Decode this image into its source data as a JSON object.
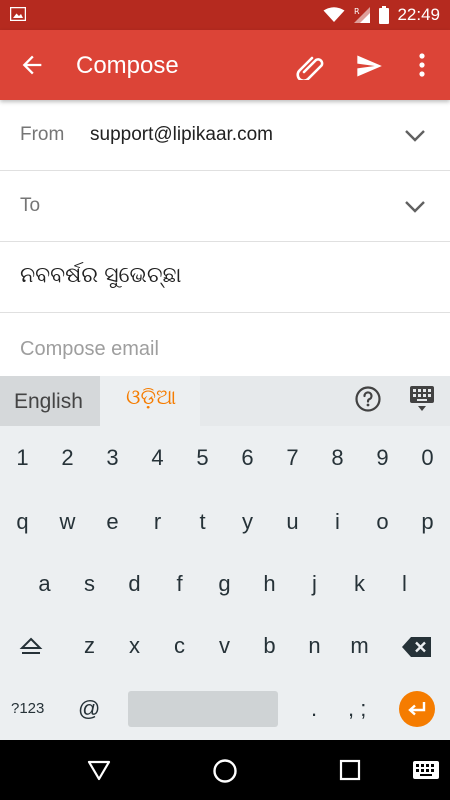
{
  "status_bar": {
    "time": "22:49",
    "icons": [
      "image-icon",
      "wifi-icon",
      "signal-icon",
      "battery-icon"
    ]
  },
  "app_bar": {
    "title": "Compose",
    "icons": [
      "back-arrow-icon",
      "attach-icon",
      "send-icon",
      "more-vert-icon"
    ],
    "color": "#dc4437"
  },
  "compose": {
    "from_label": "From",
    "from_value": "support@lipikaar.com",
    "to_label": "To",
    "to_value": "",
    "subject_value": "ନବବର୍ଷର ସୁଭେଚ୍ଛା",
    "body_placeholder": "Compose email"
  },
  "keyboard": {
    "lang_english": "English",
    "lang_odia": "ଓଡ଼ିଆ",
    "accent": "#f57c00",
    "number_row": [
      "1",
      "2",
      "3",
      "4",
      "5",
      "6",
      "7",
      "8",
      "9",
      "0"
    ],
    "row_q": [
      "q",
      "w",
      "e",
      "r",
      "t",
      "y",
      "u",
      "i",
      "o",
      "p"
    ],
    "row_a": [
      "a",
      "s",
      "d",
      "f",
      "g",
      "h",
      "j",
      "k",
      "l"
    ],
    "row_z": [
      "z",
      "x",
      "c",
      "v",
      "b",
      "n",
      "m"
    ],
    "symbols_key": "?123",
    "at_key": "@",
    "dot_key": ".",
    "punct_key": ", ;"
  },
  "nav_bar": {
    "icons": [
      "nav-back-icon",
      "nav-home-icon",
      "nav-recents-icon",
      "keyboard-switch-icon"
    ]
  }
}
